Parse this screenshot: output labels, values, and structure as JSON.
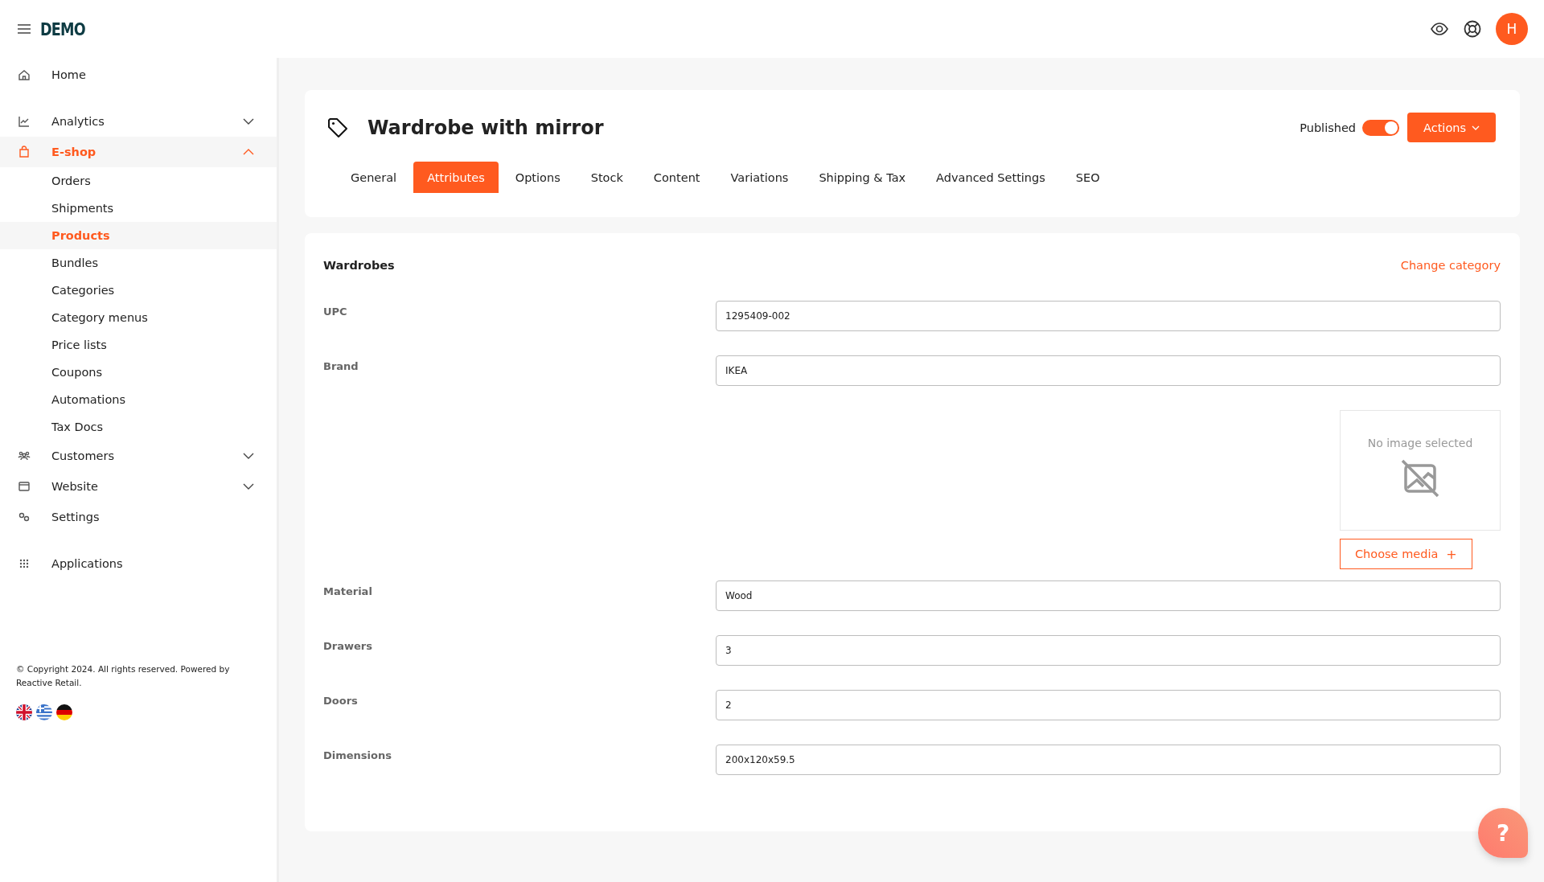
{
  "header": {
    "logo": "DEMO"
  },
  "sidebar": {
    "items": [
      {
        "label": "Home",
        "selected": false
      },
      {
        "label": "Analytics",
        "expanded": false,
        "selected": false
      },
      {
        "label": "E-shop",
        "expanded": true,
        "selected": true,
        "children": [
          {
            "label": "Orders",
            "selected": false
          },
          {
            "label": "Shipments",
            "selected": false
          },
          {
            "label": "Products",
            "selected": true
          },
          {
            "label": "Bundles",
            "selected": false
          },
          {
            "label": "Categories",
            "selected": false
          },
          {
            "label": "Category menus",
            "selected": false
          },
          {
            "label": "Price lists",
            "selected": false
          },
          {
            "label": "Coupons",
            "selected": false
          },
          {
            "label": "Automations",
            "selected": false
          },
          {
            "label": "Tax Docs",
            "selected": false
          }
        ]
      },
      {
        "label": "Customers",
        "expanded": false,
        "selected": false
      },
      {
        "label": "Website",
        "expanded": false,
        "selected": false
      },
      {
        "label": "Settings",
        "selected": false
      },
      {
        "label": "Applications",
        "selected": false
      }
    ],
    "copyright": "© Copyright 2024. All rights reserved. Powered by Reactive Retail."
  },
  "product": {
    "title": "Wardrobe with mirror",
    "published_label": "Published",
    "published": true,
    "actions": "Actions",
    "tabs": [
      {
        "label": "General",
        "selected": false
      },
      {
        "label": "Attributes",
        "selected": true
      },
      {
        "label": "Options",
        "selected": false
      },
      {
        "label": "Stock",
        "selected": false
      },
      {
        "label": "Content",
        "selected": false
      },
      {
        "label": "Variations",
        "selected": false
      },
      {
        "label": "Shipping & Tax",
        "selected": false
      },
      {
        "label": "Advanced Settings",
        "selected": false
      },
      {
        "label": "SEO",
        "selected": false
      }
    ]
  },
  "attributes": {
    "category": "Wardrobes",
    "change_category": "Change category",
    "fields": [
      {
        "kind": "text",
        "label": "UPC",
        "value": "1295409-002"
      },
      {
        "kind": "text",
        "label": "Brand",
        "value": "IKEA"
      },
      {
        "kind": "image",
        "empty_text": "No image selected",
        "button": "Choose media",
        "button_icon": "+"
      },
      {
        "kind": "text",
        "label": "Material",
        "value": "Wood"
      },
      {
        "kind": "text",
        "label": "Drawers",
        "value": "3"
      },
      {
        "kind": "text",
        "label": "Doors",
        "value": "2"
      },
      {
        "kind": "text",
        "label": "Dimensions",
        "value": "200x120x59.5"
      }
    ]
  },
  "help": {
    "label": "?"
  },
  "user": {
    "initial": "H"
  }
}
